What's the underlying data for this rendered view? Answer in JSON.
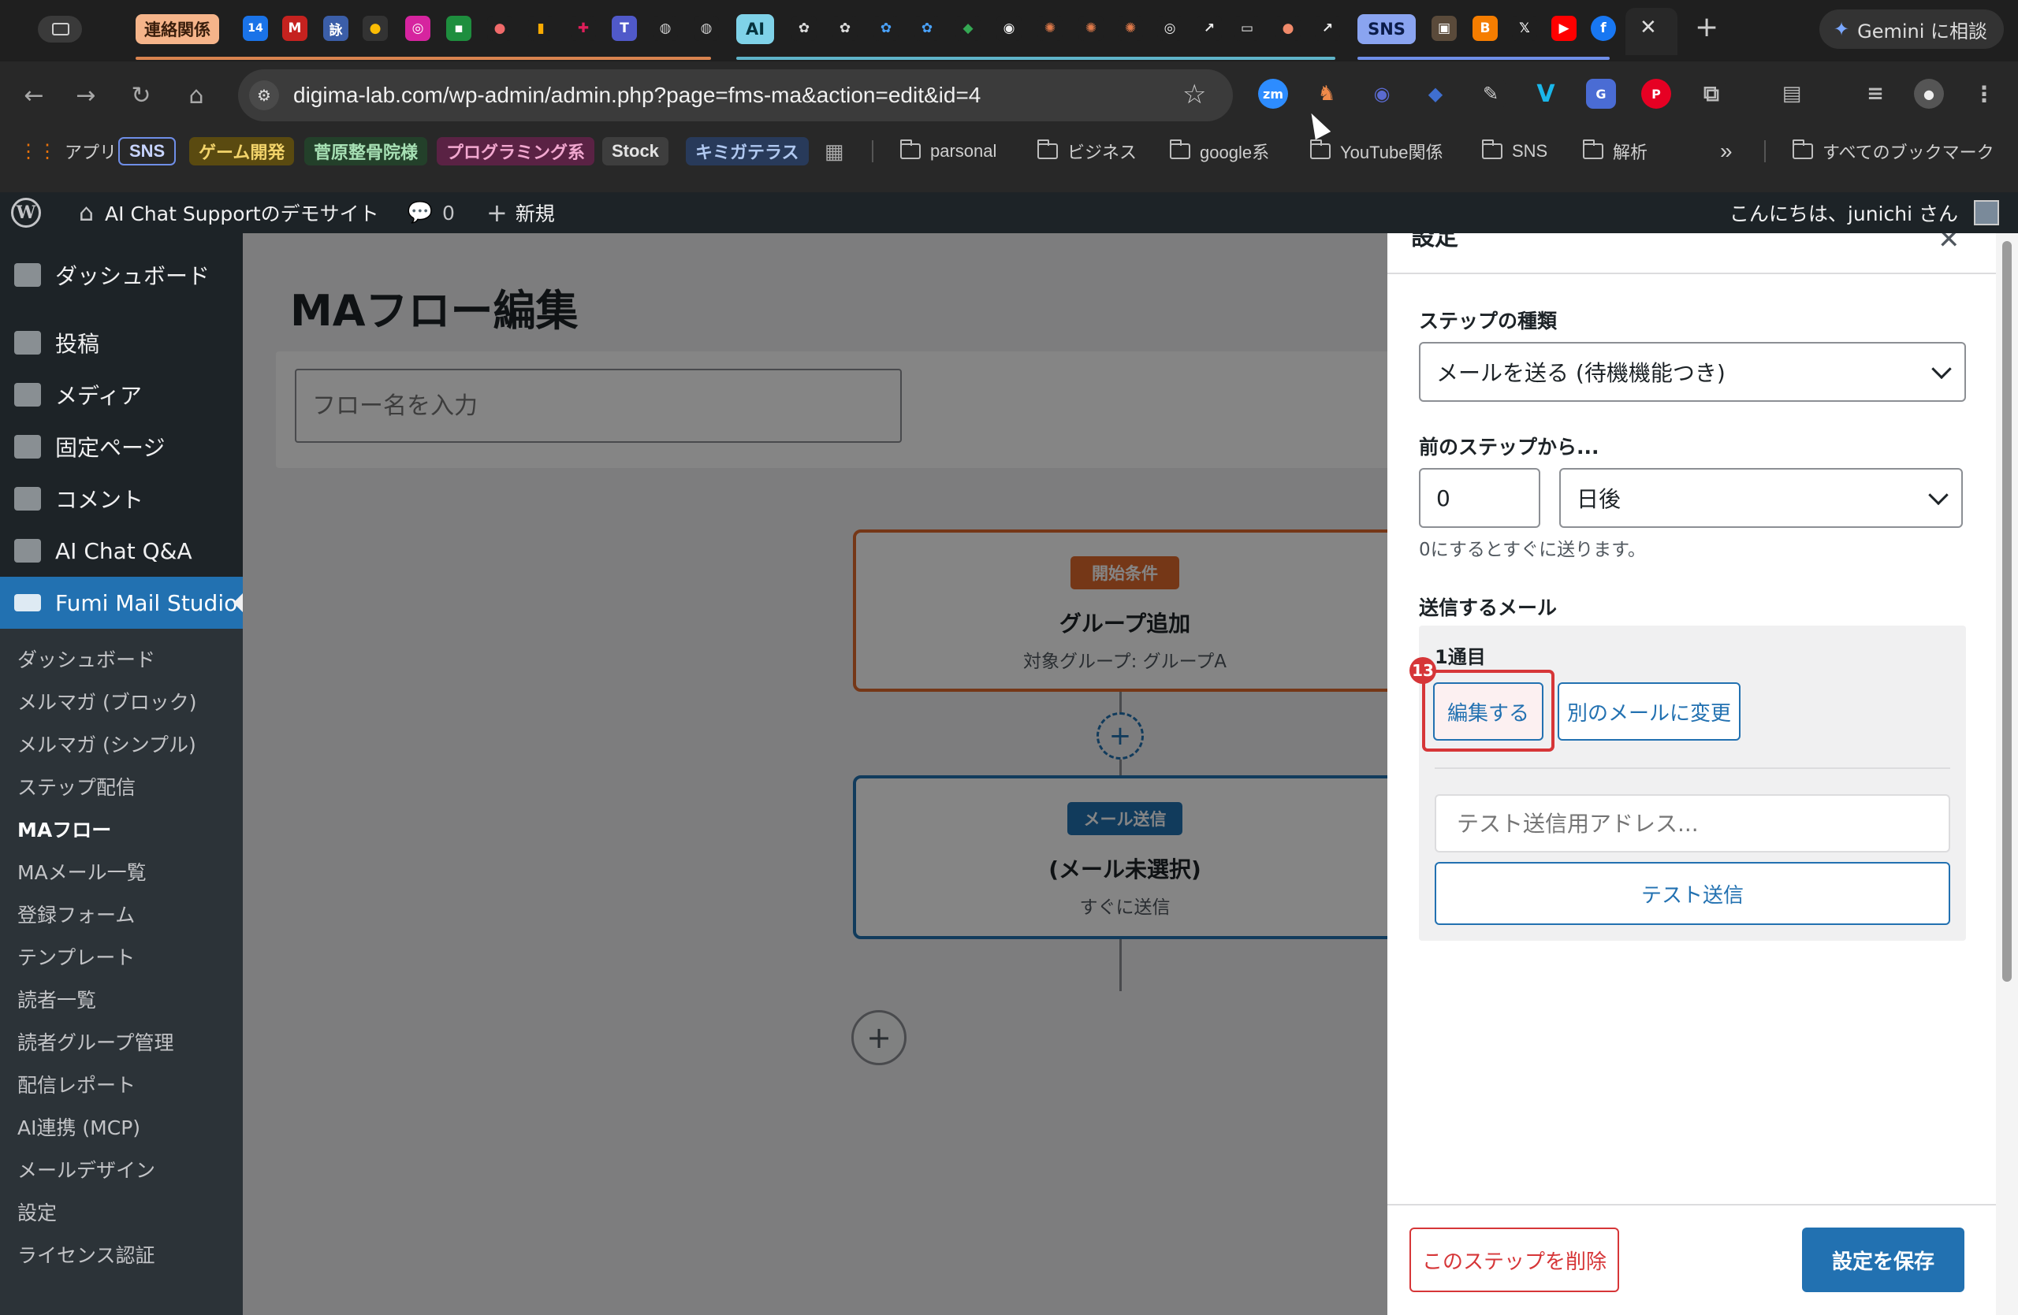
{
  "browser": {
    "url": "digima-lab.com/wp-admin/admin.php?page=fms-ma&action=edit&id=4",
    "tab_group_1": "連絡関係",
    "tab_group_2": "SNS",
    "calendar_day": "14",
    "gemini_button": "Gemini に相談",
    "new_tab": "+",
    "close_tab": "✕"
  },
  "bookmarks": {
    "apps": "アプリ",
    "chips": [
      "SNS",
      "ゲーム開発",
      "菅原整骨院様",
      "プログラミング系",
      "Stock",
      "キミガテラス"
    ],
    "folders": [
      "parsonal",
      "ビジネス",
      "google系",
      "YouTube関係",
      "SNS",
      "解析"
    ],
    "overflow": "»",
    "all_bookmarks": "すべてのブックマーク"
  },
  "adminbar": {
    "site_name": "AI Chat Supportのデモサイト",
    "comments_count": "0",
    "new_label": "新規",
    "greeting": "こんにちは、junichi さん"
  },
  "sidebar": {
    "items": [
      "ダッシュボード",
      "投稿",
      "メディア",
      "固定ページ",
      "コメント",
      "AI Chat Q&A",
      "Fumi Mail Studio"
    ],
    "submenu": [
      "ダッシュボード",
      "メルマガ (ブロック)",
      "メルマガ (シンプル)",
      "ステップ配信",
      "MAフロー",
      "MAメール一覧",
      "登録フォーム",
      "テンプレート",
      "読者一覧",
      "読者グループ管理",
      "配信レポート",
      "AI連携 (MCP)",
      "メールデザイン",
      "設定",
      "ライセンス認証"
    ]
  },
  "main": {
    "title": "MAフロー編集",
    "flow_name_placeholder": "フロー名を入力",
    "node1": {
      "badge": "開始条件",
      "title": "グループ追加",
      "subtitle": "対象グループ: グループA"
    },
    "node2": {
      "badge": "メール送信",
      "title": "(メール未選択)",
      "subtitle": "すぐに送信"
    },
    "add_step": "+"
  },
  "panel": {
    "title": "設定",
    "close": "✕",
    "step_type_label": "ステップの種類",
    "step_type_value": "メールを送る (待機機能つき)",
    "delay_label": "前のステップから...",
    "delay_value": "0",
    "delay_unit": "日後",
    "delay_hint": "0にするとすぐに送ります。",
    "send_mail_label": "送信するメール",
    "mail_index": "1通目",
    "annotation_number": "13",
    "edit_button": "編集する",
    "change_button": "別のメールに変更",
    "test_address_placeholder": "テスト送信用アドレス...",
    "test_send_button": "テスト送信",
    "delete_button": "このステップを削除",
    "save_button": "設定を保存"
  },
  "colors": {
    "wp_blue": "#2271b1",
    "accent_orange": "#e06a2c",
    "highlight_red": "#d63638"
  }
}
